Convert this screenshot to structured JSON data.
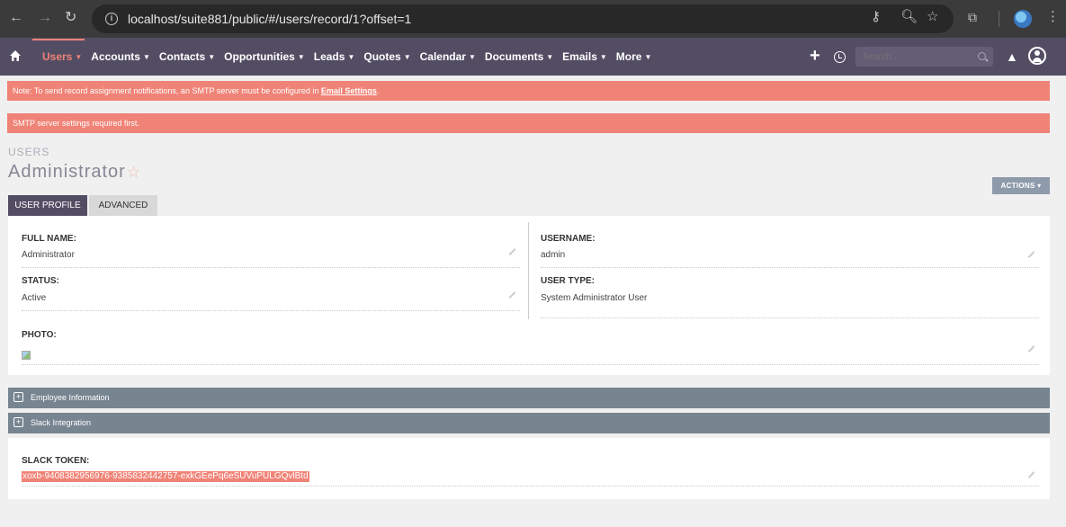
{
  "browser": {
    "url": "localhost/suite881/public/#/users/record/1?offset=1",
    "icons": [
      "back-arrow-icon",
      "forward-arrow-icon",
      "reload-icon",
      "site-info-icon",
      "key-icon",
      "zoom-icon",
      "star-icon",
      "extensions-icon",
      "profile-icon",
      "kebab-menu-icon"
    ]
  },
  "nav": {
    "items": [
      {
        "label": "Users",
        "active": true
      },
      {
        "label": "Accounts"
      },
      {
        "label": "Contacts"
      },
      {
        "label": "Opportunities"
      },
      {
        "label": "Leads"
      },
      {
        "label": "Quotes"
      },
      {
        "label": "Calendar"
      },
      {
        "label": "Documents"
      },
      {
        "label": "Emails"
      },
      {
        "label": "More"
      }
    ],
    "search_placeholder": "Search...",
    "accent": "#f08377",
    "bar_color": "#534d64"
  },
  "alerts": {
    "smtp_note_prefix": "Note: To send record assignment notifications, an SMTP server must be configured in ",
    "smtp_note_link": "Email Settings",
    "smtp_note_suffix": ".",
    "smtp_required": "SMTP server settings required first."
  },
  "record": {
    "module": "USERS",
    "title": "Administrator",
    "actions_label": "ACTIONS"
  },
  "tabs": [
    {
      "label": "USER PROFILE",
      "active": true
    },
    {
      "label": "ADVANCED",
      "active": false
    }
  ],
  "fields": {
    "full_name_label": "FULL NAME:",
    "full_name_value": "Administrator",
    "username_label": "USERNAME:",
    "username_value": "admin",
    "status_label": "STATUS:",
    "status_value": "Active",
    "user_type_label": "USER TYPE:",
    "user_type_value": "System Administrator User",
    "photo_label": "PHOTO:"
  },
  "sections": {
    "employee": "Employee Information",
    "slack": "Slack Integration"
  },
  "slack": {
    "token_label": "SLACK TOKEN:",
    "token_value": "xoxb-9408382956976-9385832442757-exkGEePq6eSUVuPULGQvlBtd"
  }
}
